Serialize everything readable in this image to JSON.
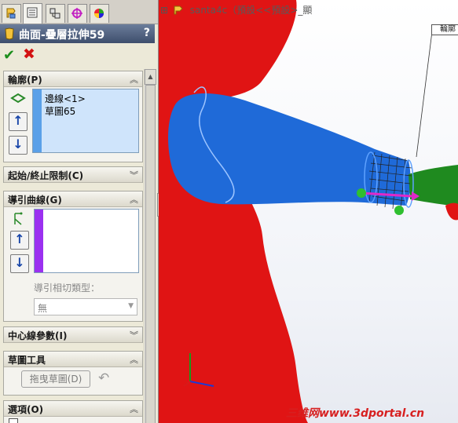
{
  "panel": {
    "tabs": [
      {
        "icon": "feature-manager-icon",
        "active": false
      },
      {
        "icon": "property-manager-icon",
        "active": true
      },
      {
        "icon": "configuration-manager-icon",
        "active": false
      },
      {
        "icon": "dimxpert-icon",
        "active": false
      },
      {
        "icon": "display-manager-icon",
        "active": false
      }
    ],
    "title": "曲面-疊層拉伸59",
    "help": "?",
    "ok_icon": "check-icon",
    "cancel_icon": "x-icon",
    "profile": {
      "header": "輪廓(P)",
      "items": [
        "邊線<1>",
        "草圖65"
      ]
    },
    "start_end": {
      "header": "起始/終止限制(C)"
    },
    "guide": {
      "header": "導引曲線(G)",
      "tangency_label": "導引相切類型：",
      "tangency_value": "無"
    },
    "centerline": {
      "header": "中心線參數(I)"
    },
    "sketch_tools": {
      "header": "草圖工具",
      "drag_button": "拖曳草圖(D)"
    },
    "options": {
      "header": "選項(O)"
    }
  },
  "viewport": {
    "tree_label": "santa4c（預設<<預設>_顯",
    "callout": "輪廓",
    "watermark": "三维网www.3dportal.cn"
  },
  "colors": {
    "accent_title": "#3e4e6c",
    "profile_bar": "#5aa0e8",
    "guide_bar": "#9b30f0",
    "body_red": "#e01414",
    "surface_blue": "#1f6ad8",
    "arm_green": "#1f8a1f"
  }
}
